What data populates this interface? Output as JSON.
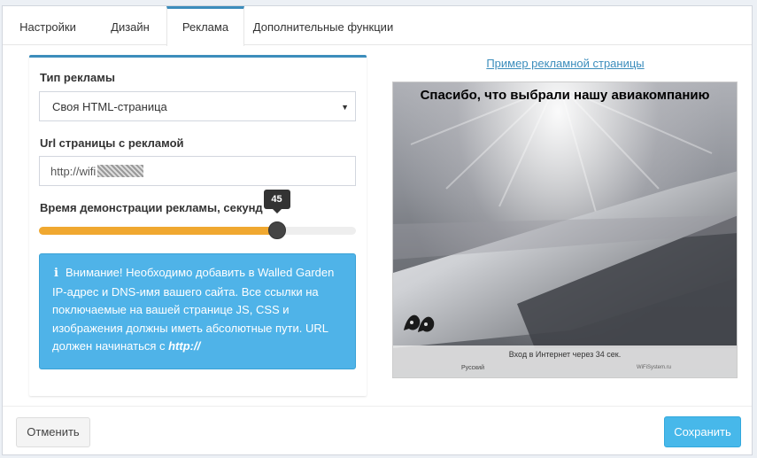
{
  "tabs": [
    {
      "label": "Настройки",
      "active": false
    },
    {
      "label": "Дизайн",
      "active": false
    },
    {
      "label": "Реклама",
      "active": true
    },
    {
      "label": "Дополнительные функции",
      "active": false
    }
  ],
  "form": {
    "ad_type_label": "Тип рекламы",
    "ad_type_value": "Своя HTML-страница",
    "url_label": "Url страницы с рекламой",
    "url_value": "http://wifi",
    "duration_label": "Время демонстрации рекламы, секунд",
    "duration_value": "45",
    "duration_fraction": 0.75,
    "alert": {
      "icon": "info-icon",
      "text_before": "Внимание! Необходимо добавить в Walled Garden IP-адрес и DNS-имя вашего сайта. Все ссылки на поключаемые на вашей странице JS, CSS и изображения должны иметь абсолютные пути. URL должен начинаться с ",
      "text_emph": "http://"
    }
  },
  "preview": {
    "link": "Пример рекламной страницы",
    "title": "Спасибо, что выбрали нашу авиакомпанию",
    "bar_message": "Вход в Интернет через 34 сек.",
    "bar_lang": "Русский",
    "bar_brand": "WiFiSystem.ru"
  },
  "footer": {
    "cancel_label": "Отменить",
    "save_label": "Сохранить"
  },
  "colors": {
    "accent": "#3c8dbc",
    "slider_fill": "#f0a830",
    "alert_bg": "#4fb3e8",
    "save_bg": "#47b8ea"
  }
}
